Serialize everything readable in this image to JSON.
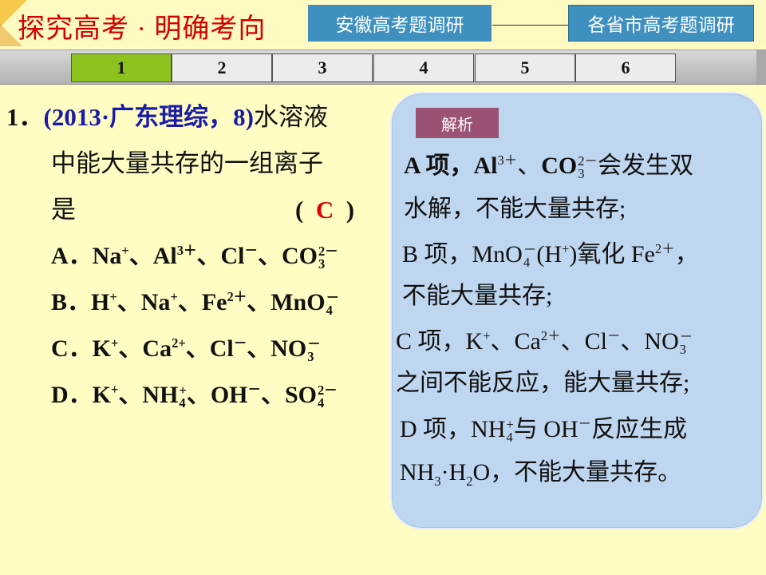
{
  "header": {
    "title": "探究高考 · 明确考向",
    "tab_left": "安徽高考题调研",
    "tab_right": "各省市高考题调研"
  },
  "pagination": {
    "pages": [
      "1",
      "2",
      "3",
      "4",
      "5",
      "6"
    ],
    "active": "1"
  },
  "question": {
    "number": "1．",
    "source": "(2013·广东理综，8)",
    "stem_1": "水溶液",
    "stem_2": "中能大量共存的一组离子",
    "stem_3": "是",
    "paren_open": "(",
    "answer": "C",
    "paren_close": ")",
    "options": {
      "A": {
        "label": "A．",
        "i1": "Na",
        "c1": "+",
        "i2": "Al",
        "c2": "3＋",
        "i3": "Cl",
        "c3": "－",
        "i4": "CO",
        "s4": "3",
        "c4": "2－"
      },
      "B": {
        "label": "B．",
        "i1": "H",
        "c1": "+",
        "i2": "Na",
        "c2": "+",
        "i3": "Fe",
        "c3": "2＋",
        "i4": "MnO",
        "s4": "4",
        "c4": "－"
      },
      "C": {
        "label": "C．",
        "i1": "K",
        "c1": "+",
        "i2": "Ca",
        "c2": "2+",
        "i3": "Cl",
        "c3": "－",
        "i4": "NO",
        "s4": "3",
        "c4": "－"
      },
      "D": {
        "label": "D．",
        "i1": "K",
        "c1": "+",
        "i2": "NH",
        "s2": "4",
        "c2": "+",
        "i3": "OH",
        "c3": "－",
        "i4": "SO",
        "s4": "4",
        "c4": "2－"
      }
    },
    "sep": "、"
  },
  "analysis": {
    "label": "解析",
    "a1_pre": "A 项，",
    "a1_al": "Al",
    "a1_al_c": "3＋",
    "a1_co": "CO",
    "a1_co_s": "3",
    "a1_co_c": "2－",
    "a1_post": "会发生双",
    "a2": "水解，不能大量共存;",
    "b1_pre": "B 项，MnO",
    "b1_s": "4",
    "b1_c": "－",
    "b1_h": "(H",
    "b1_hc": "+",
    "b1_mid": ")氧化 Fe",
    "b1_fec": "2＋",
    "b1_post": "，",
    "b2": "不能大量共存;",
    "c1_pre": "C 项，K",
    "c1_kc": "+",
    "c1_ca": "、Ca",
    "c1_cac": "2＋",
    "c1_cl": "、Cl",
    "c1_clc": "－",
    "c1_no": "、NO",
    "c1_nos": "3",
    "c1_noc": "－",
    "c2": "之间不能反应，能大量共存;",
    "d1_pre": "D 项，NH",
    "d1_s": "4",
    "d1_c": "+",
    "d1_mid": "与 OH",
    "d1_ohc": "－",
    "d1_post": "反应生成",
    "d2_a": "NH",
    "d2_s1": "3",
    "d2_b": "·H",
    "d2_s2": "2",
    "d2_c": "O，不能大量共存。"
  }
}
